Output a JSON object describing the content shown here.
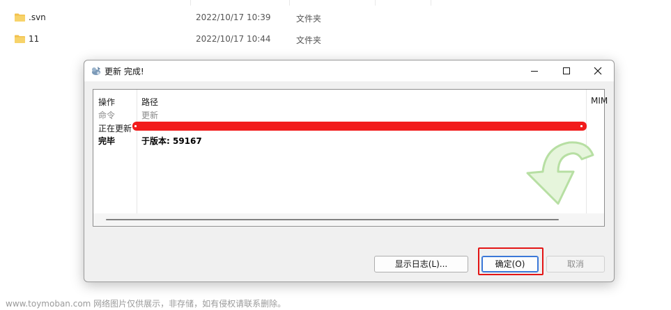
{
  "explorer": {
    "rows": [
      {
        "name": ".svn",
        "date": "2022/10/17 10:39",
        "type": "文件夹"
      },
      {
        "name": "11",
        "date": "2022/10/17 10:44",
        "type": "文件夹"
      }
    ]
  },
  "dialog": {
    "title": "更新 完成!",
    "list": {
      "headers": {
        "action": "操作",
        "path": "路径",
        "mime": "MIM"
      },
      "rows": [
        {
          "action": "命令",
          "path": "更新",
          "style": "grey"
        },
        {
          "action": "正在更新",
          "path": "",
          "style": "normal"
        },
        {
          "action": "完毕",
          "path": "于版本: 59167",
          "style": "bold"
        }
      ]
    },
    "buttons": {
      "show_log": "显示日志(L)...",
      "ok": "确定(O)",
      "cancel": "取消"
    }
  },
  "footer": "www.toymoban.com 网络图片仅供展示，非存储，如有侵权请联系删除。",
  "colors": {
    "redaction": "#f21b1b",
    "highlight": "#e31414",
    "folder": "#f2c14e",
    "accent": "#3b78d8"
  }
}
